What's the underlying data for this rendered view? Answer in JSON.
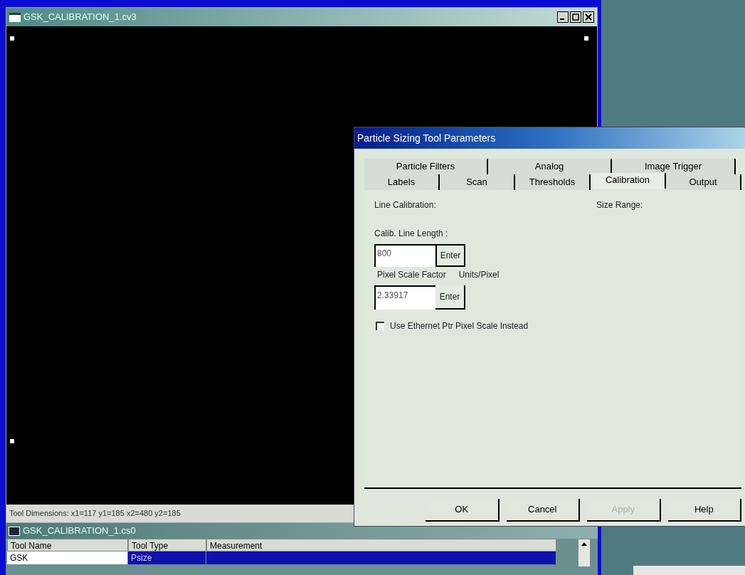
{
  "image_window": {
    "title": "GSK_CALIBRATION_1.cv3",
    "status": "Tool Dimensions: x1=117 y1=185 x2=480 y2=185"
  },
  "dialog": {
    "title": "Particle Sizing Tool Parameters",
    "tab_rows": [
      [
        {
          "label": "Particle Filters",
          "selected": false
        },
        {
          "label": "Analog",
          "selected": false
        },
        {
          "label": "Image Trigger",
          "selected": false
        }
      ],
      [
        {
          "label": "Labels",
          "selected": false
        },
        {
          "label": "Scan",
          "selected": false
        },
        {
          "label": "Thresholds",
          "selected": false
        },
        {
          "label": "Calibration",
          "selected": true
        },
        {
          "label": "Output",
          "selected": false
        }
      ]
    ],
    "line_calibration": "Line Calibration:",
    "size_range": "Size Range:",
    "calib_label": "Calib. Line Length :",
    "calib_value": "800",
    "enter_1": "Enter",
    "scale_label": "Pixel Scale Factor",
    "units": "Units/Pixel",
    "scale_value": "2.33917",
    "enter_2": "Enter",
    "checkbox": {
      "label": "Use Ethernet Ptr Pixel Scale Instead",
      "checked": false
    },
    "buttons": [
      {
        "label": "OK",
        "disabled": false
      },
      {
        "label": "Cancel",
        "disabled": false
      },
      {
        "label": "Apply",
        "disabled": true
      },
      {
        "label": "Help",
        "disabled": false
      }
    ]
  },
  "tool_window": {
    "title": "GSK_CALIBRATION_1.cs0",
    "columns": [
      "Tool Name",
      "Tool Type",
      "Measurement"
    ],
    "rows": [
      {
        "cells": [
          "GSK",
          "Psize",
          ""
        ],
        "selected": true
      }
    ]
  }
}
